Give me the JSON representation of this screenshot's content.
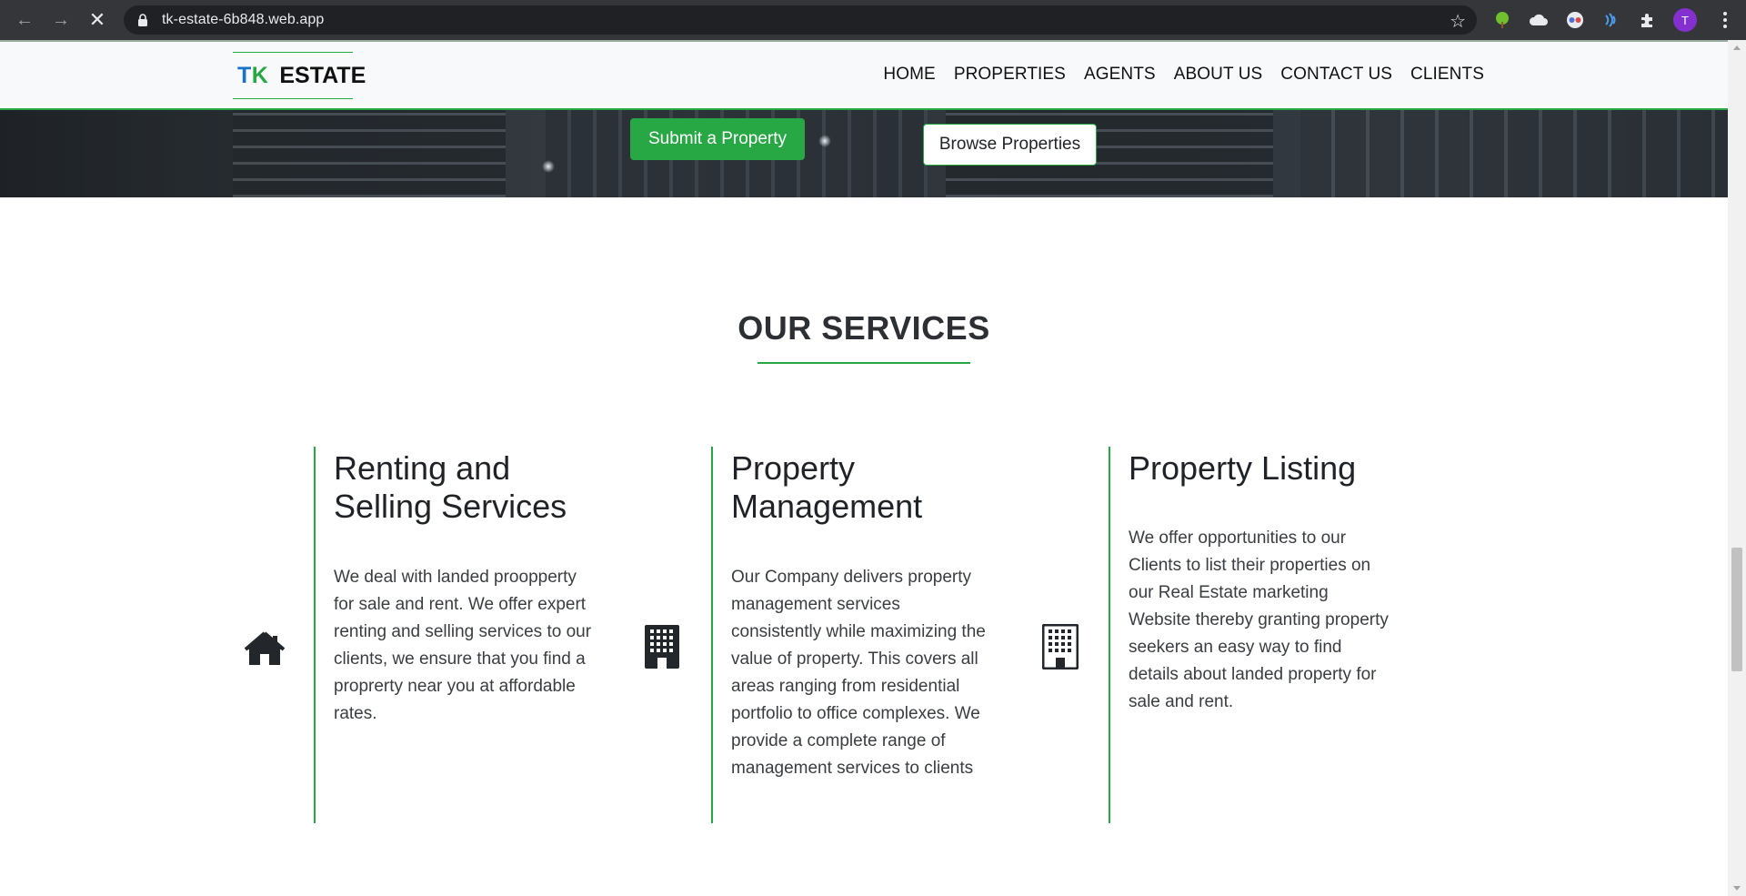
{
  "browser": {
    "url": "tk-estate-6b848.web.app",
    "profile_initial": "T",
    "extensions": [
      "tree-extension-icon",
      "cloud-extension-icon",
      "glasses-extension-icon",
      "wave-extension-icon",
      "puzzle-extensions-icon"
    ]
  },
  "header": {
    "brand_tk": "TK",
    "brand_estate": "ESTATE",
    "nav": [
      "HOME",
      "PROPERTIES",
      "AGENTS",
      "ABOUT US",
      "CONTACT US",
      "CLIENTS"
    ]
  },
  "hero": {
    "submit_label": "Submit a Property",
    "browse_label": "Browse Properties"
  },
  "services": {
    "title": "OUR SERVICES",
    "items": [
      {
        "icon": "house-icon",
        "heading": "Renting and Selling Services",
        "text": "We deal with landed proopperty for sale and rent. We offer expert renting and selling services to our clients, we ensure that you find a proprerty near you at affordable rates."
      },
      {
        "icon": "building-icon",
        "heading": "Property Management",
        "text": "Our Company delivers property management services consistently while maximizing the value of property. This covers all areas ranging from residential portfolio to office complexes. We provide a complete range of management services to clients"
      },
      {
        "icon": "building-icon",
        "heading": "Property Listing",
        "text": "We offer opportunities to our Clients to list their properties on our Real Estate marketing Website thereby granting property seekers an easy way to find details about landed property for sale and rent."
      }
    ]
  },
  "colors": {
    "accent_green": "#28a745",
    "brand_blue": "#1a73c8"
  }
}
